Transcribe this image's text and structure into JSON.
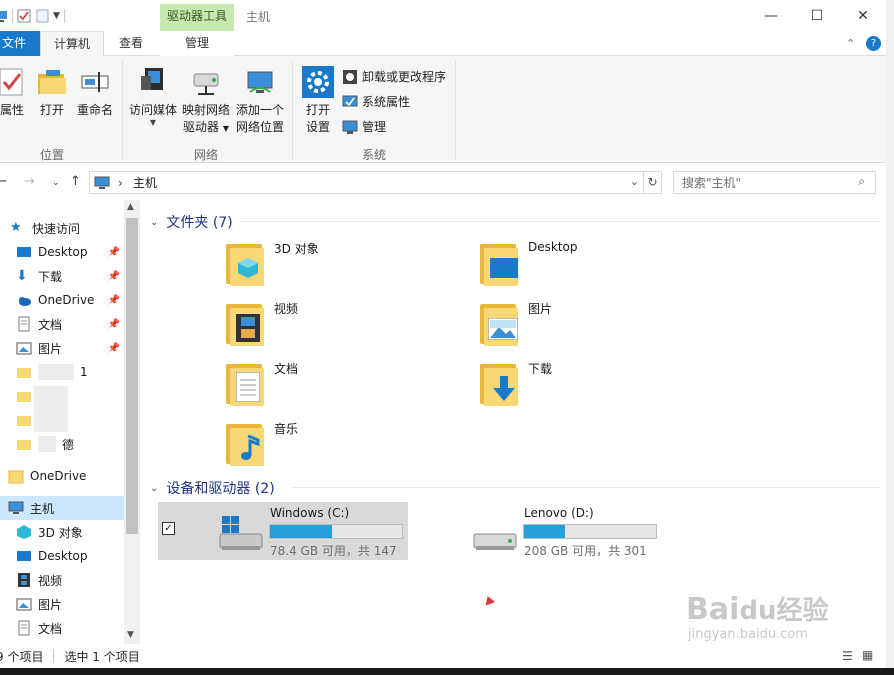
{
  "window": {
    "title": "主机",
    "context_tab_group": "驱动器工具",
    "minimize": "—",
    "maximize": "☐",
    "close": "✕"
  },
  "ribbon_tabs": {
    "file": "文件",
    "computer": "计算机",
    "view": "查看",
    "manage": "管理"
  },
  "ribbon": {
    "location": {
      "label": "位置",
      "properties": "属性",
      "open": "打开",
      "rename": "重命名"
    },
    "network": {
      "label": "网络",
      "access_media": "访问媒体",
      "map_drive_line1": "映射网络",
      "map_drive_line2": "驱动器",
      "add_location_line1": "添加一个",
      "add_location_line2": "网络位置"
    },
    "system": {
      "label": "系统",
      "open_settings_line1": "打开",
      "open_settings_line2": "设置",
      "uninstall": "卸载或更改程序",
      "system_properties": "系统属性",
      "manage": "管理"
    }
  },
  "address": {
    "separator": "›",
    "path": "主机",
    "search_placeholder": "搜索\"主机\""
  },
  "nav_pane": {
    "quick_access": "快速访问",
    "items": [
      {
        "label": "Desktop"
      },
      {
        "label": "下载"
      },
      {
        "label": "OneDrive"
      },
      {
        "label": "文档"
      },
      {
        "label": "图片"
      },
      {
        "label": "1"
      },
      {
        "label": "德"
      }
    ],
    "onedrive": "OneDrive",
    "this_pc": "主机",
    "pc_items": [
      {
        "label": "3D 对象"
      },
      {
        "label": "Desktop"
      },
      {
        "label": "视频"
      },
      {
        "label": "图片"
      },
      {
        "label": "文档"
      }
    ]
  },
  "content": {
    "folders_header": "文件夹 (7)",
    "folders": [
      {
        "name": "3D 对象"
      },
      {
        "name": "Desktop"
      },
      {
        "name": "视频"
      },
      {
        "name": "图片"
      },
      {
        "name": "文档"
      },
      {
        "name": "下载"
      },
      {
        "name": "音乐"
      }
    ],
    "drives_header": "设备和驱动器 (2)",
    "drives": [
      {
        "name": "Windows (C:)",
        "free": "78.4 GB 可用，共 147",
        "used_fraction": 0.47
      },
      {
        "name": "Lenovo (D:)",
        "free": "208 GB 可用，共 301",
        "used_fraction": 0.31
      }
    ]
  },
  "status": {
    "item_count": "9 个项目",
    "selected": "选中 1 个项目"
  },
  "watermark": {
    "brand": "Bai",
    "brand_paw": "du",
    "brand_cn": "经验",
    "url": "jingyan.baidu.com"
  },
  "colors": {
    "accent": "#1979ca",
    "context_tab": "#c7e9b0",
    "bar_fill": "#26a0da",
    "folder": "#f8d775",
    "header_blue": "#1e3287"
  }
}
